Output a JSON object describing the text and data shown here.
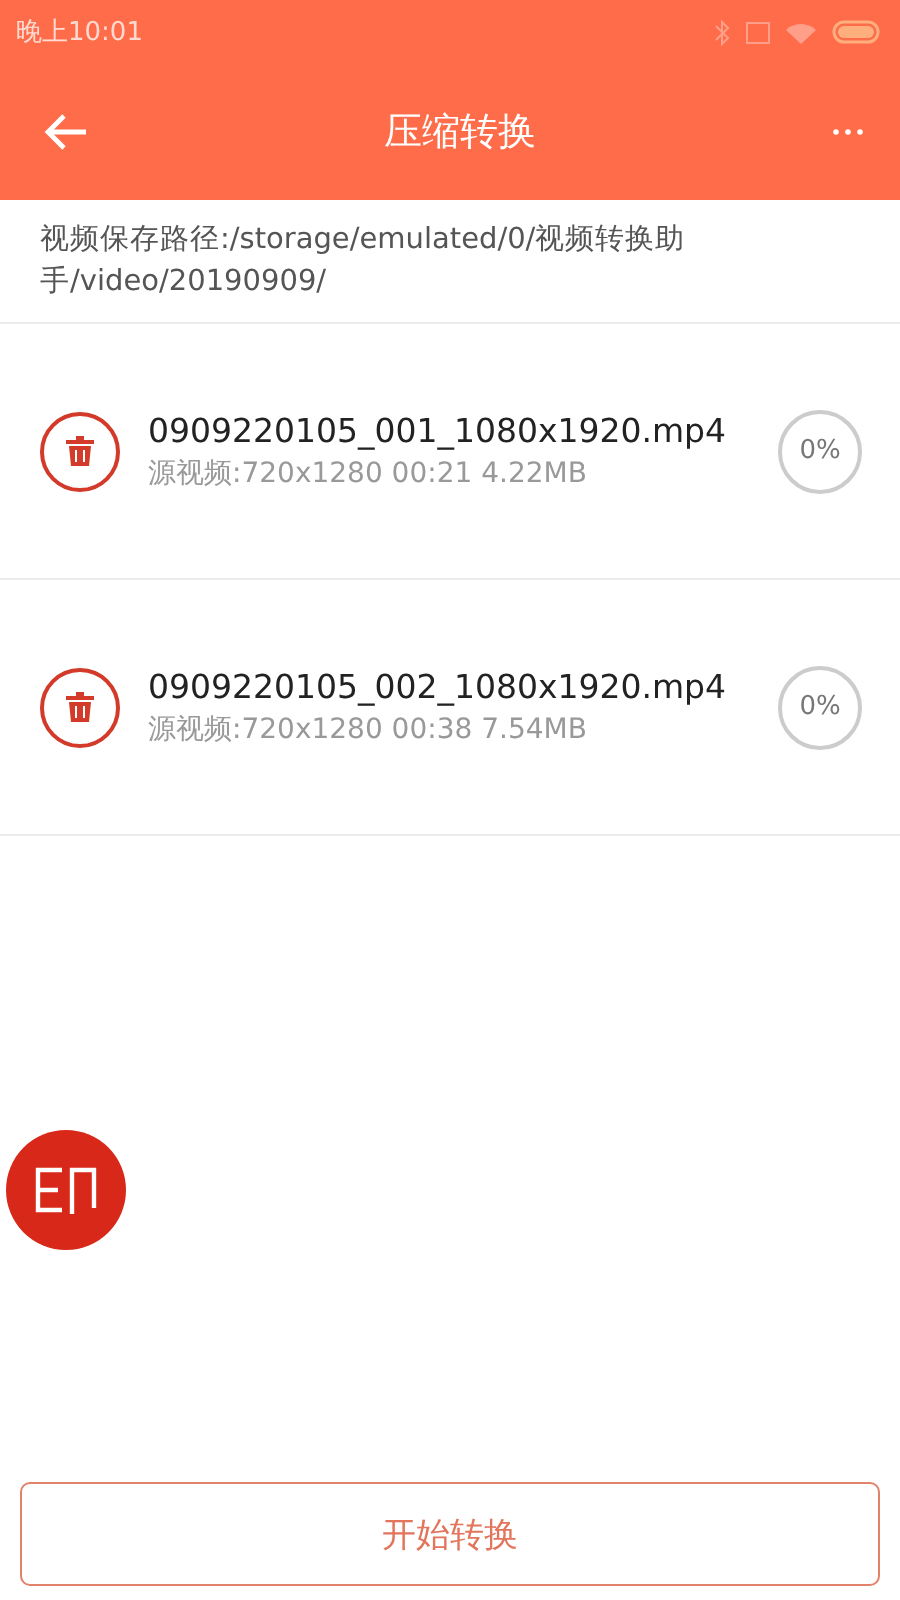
{
  "status_bar": {
    "time": "晚上10:01"
  },
  "app_bar": {
    "title": "压缩转换"
  },
  "save_path": "视频保存路径:/storage/emulated/0/视频转换助手/video/20190909/",
  "files": [
    {
      "name": "0909220105_001_1080x1920.mp4",
      "source": "源视频:720x1280 00:21 4.22MB",
      "progress": "0%"
    },
    {
      "name": "0909220105_002_1080x1920.mp4",
      "source": "源视频:720x1280 00:38 7.54MB",
      "progress": "0%"
    }
  ],
  "start_button": "开始转换"
}
